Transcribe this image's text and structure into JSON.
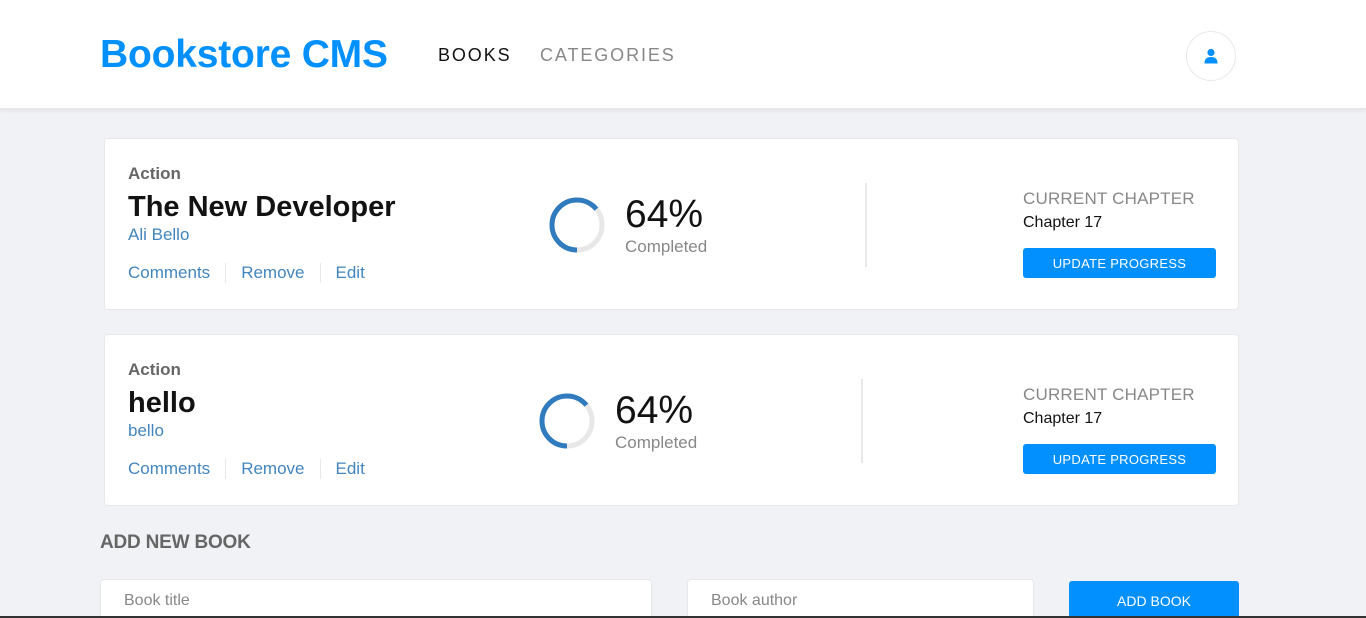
{
  "header": {
    "logo": "Bookstore CMS",
    "nav": {
      "books": "BOOKS",
      "categories": "CATEGORIES"
    },
    "user_icon": "user-icon"
  },
  "books": [
    {
      "genre": "Action",
      "title": "The New Developer",
      "author": "Ali Bello",
      "actions": {
        "comments": "Comments",
        "remove": "Remove",
        "edit": "Edit"
      },
      "progress": {
        "percent_text": "64%",
        "percent_value": 0.64,
        "completed_label": "Completed"
      },
      "current_chapter_label": "CURRENT CHAPTER",
      "current_chapter": "Chapter 17",
      "update_button": "UPDATE PROGRESS"
    },
    {
      "genre": "Action",
      "title": "hello",
      "author": "bello",
      "actions": {
        "comments": "Comments",
        "remove": "Remove",
        "edit": "Edit"
      },
      "progress": {
        "percent_text": "64%",
        "percent_value": 0.64,
        "completed_label": "Completed"
      },
      "current_chapter_label": "CURRENT CHAPTER",
      "current_chapter": "Chapter 17",
      "update_button": "UPDATE PROGRESS"
    }
  ],
  "add_form": {
    "heading": "ADD NEW BOOK",
    "title_placeholder": "Book title",
    "author_placeholder": "Book author",
    "submit_label": "ADD BOOK"
  },
  "colors": {
    "accent": "#0290ff",
    "link": "#4386bf",
    "progress": "#307bbe",
    "progress_track": "#e8e8e8",
    "background": "#f0f2f6"
  }
}
